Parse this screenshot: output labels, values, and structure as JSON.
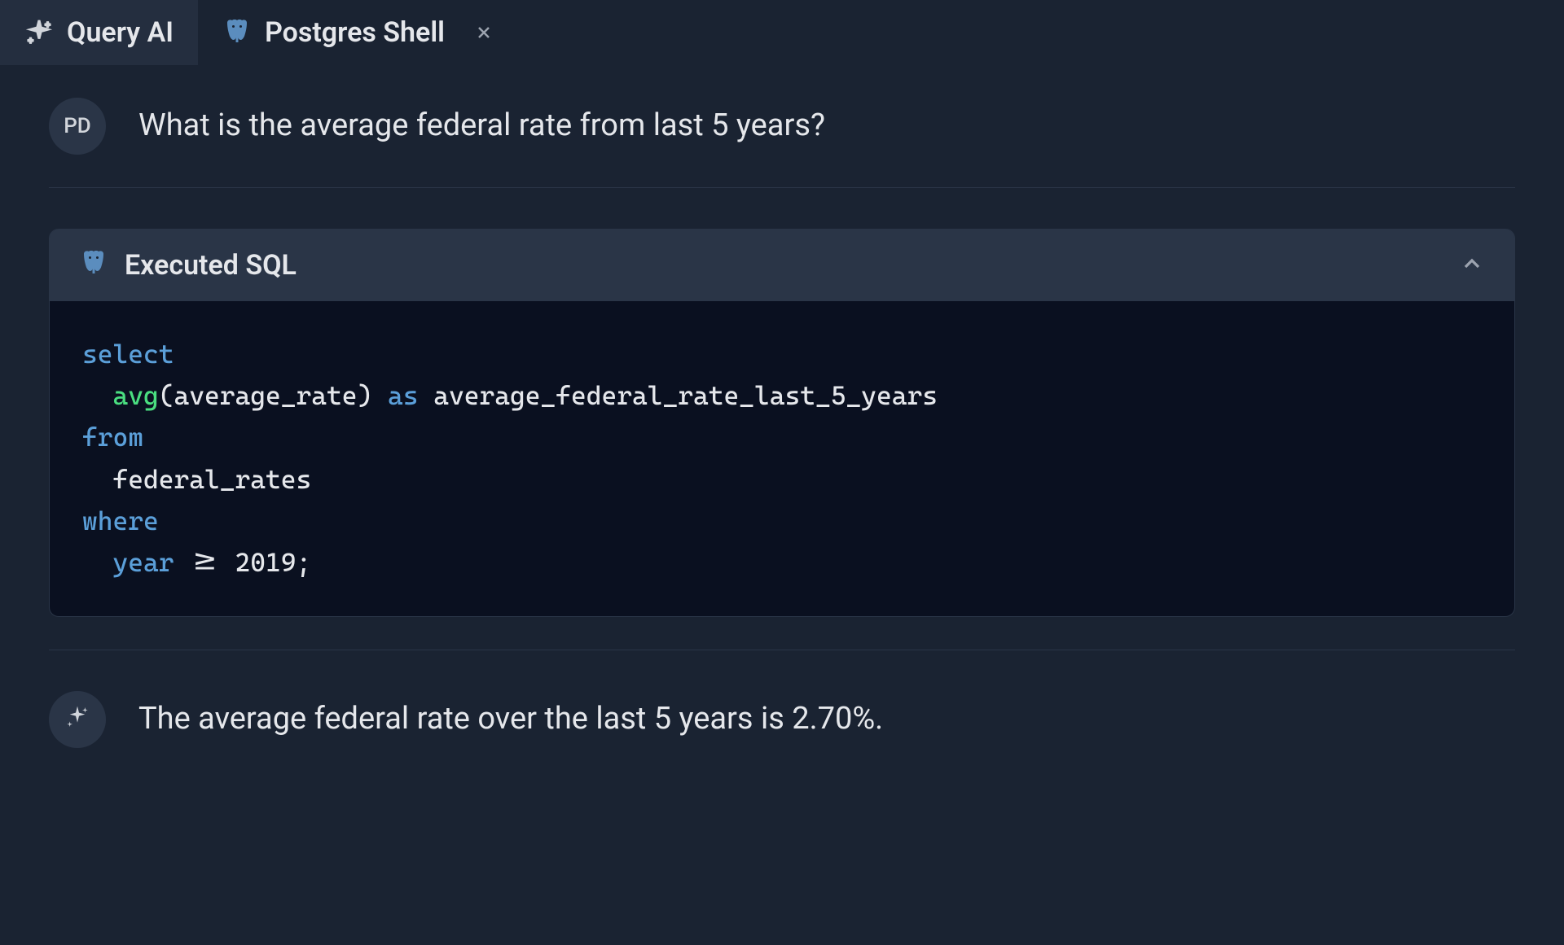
{
  "tabs": [
    {
      "label": "Query AI",
      "active": true,
      "icon": "sparkle"
    },
    {
      "label": "Postgres Shell",
      "active": false,
      "icon": "elephant",
      "closable": true
    }
  ],
  "user": {
    "initials": "PD",
    "question": "What is the average federal rate from last 5 years?"
  },
  "sql_panel": {
    "title": "Executed SQL",
    "code": {
      "tokens": [
        {
          "t": "select",
          "c": "kw-select"
        },
        {
          "t": "\n  ",
          "c": ""
        },
        {
          "t": "avg",
          "c": "kw-func"
        },
        {
          "t": "(average_rate) ",
          "c": "kw-id"
        },
        {
          "t": "as",
          "c": "kw-as"
        },
        {
          "t": " average_federal_rate_last_5_years",
          "c": "kw-id"
        },
        {
          "t": "\n",
          "c": ""
        },
        {
          "t": "from",
          "c": "kw-from"
        },
        {
          "t": "\n  federal_rates",
          "c": "kw-id"
        },
        {
          "t": "\n",
          "c": ""
        },
        {
          "t": "where",
          "c": "kw-where"
        },
        {
          "t": "\n  ",
          "c": ""
        },
        {
          "t": "year",
          "c": "kw-col"
        },
        {
          "t": " >= ",
          "c": "kw-op"
        },
        {
          "t": "2019",
          "c": "kw-num"
        },
        {
          "t": ";",
          "c": "kw-id"
        }
      ]
    }
  },
  "ai_response": "The average federal rate over the last 5 years is 2.70%."
}
